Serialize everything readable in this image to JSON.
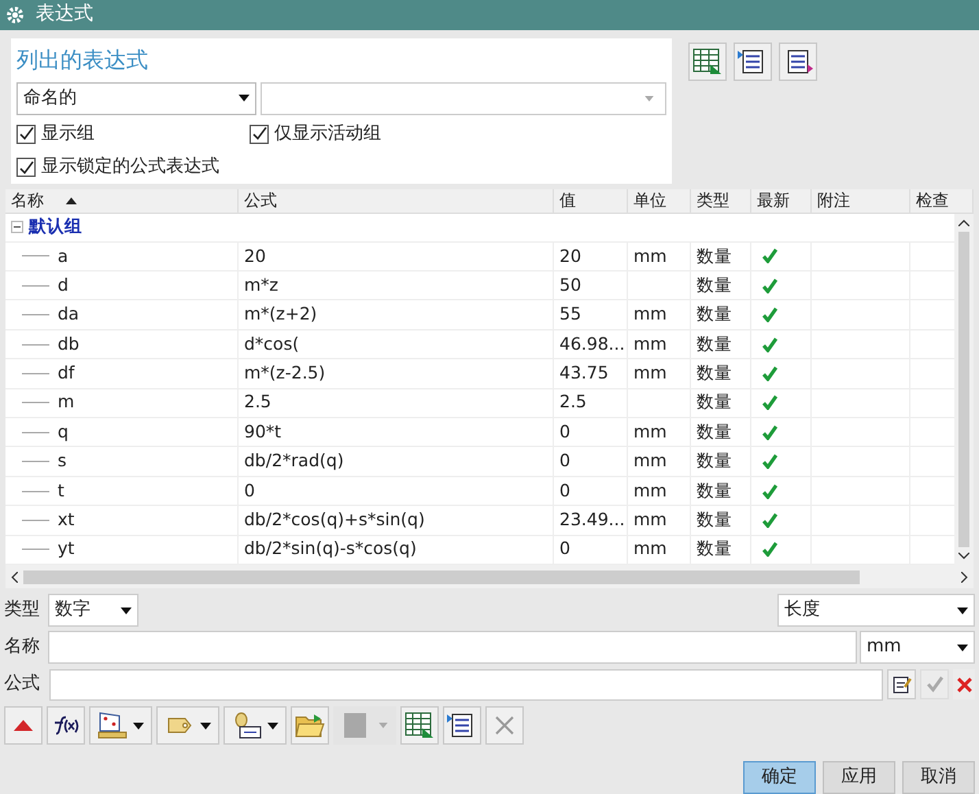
{
  "window": {
    "title": "表达式"
  },
  "listing": {
    "title": "列出的表达式",
    "filter": "命名的",
    "checkboxes": [
      {
        "label": "显示组",
        "checked": true
      },
      {
        "label": "仅显示活动组",
        "checked": true
      },
      {
        "label": "显示锁定的公式表达式",
        "checked": true
      }
    ]
  },
  "table": {
    "columns": [
      "名称",
      "公式",
      "值",
      "单位",
      "类型",
      "最新",
      "附注",
      "检查"
    ],
    "group": {
      "name": "默认组",
      "expanded": true,
      "children": [
        {
          "name": "a",
          "formula": "20",
          "value": "20",
          "unit": "mm",
          "type": "数量",
          "latest": true
        },
        {
          "name": "d",
          "formula": "m*z",
          "value": "50",
          "type": "数量",
          "latest": true
        },
        {
          "name": "da",
          "formula": "m*(z+2)",
          "value": "55",
          "unit": "mm",
          "type": "数量",
          "latest": true
        },
        {
          "name": "db",
          "formula": "d*cos(",
          "value": "46.98...",
          "unit": "mm",
          "type": "数量",
          "latest": true
        },
        {
          "name": "df",
          "formula": "m*(z-2.5)",
          "value": "43.75",
          "unit": "mm",
          "type": "数量",
          "latest": true
        },
        {
          "name": "m",
          "formula": "2.5",
          "value": "2.5",
          "type": "数量",
          "latest": true
        },
        {
          "name": "q",
          "formula": "90*t",
          "value": "0",
          "unit": "mm",
          "type": "数量",
          "latest": true
        },
        {
          "name": "s",
          "formula": "db/2*rad(q)",
          "value": "0",
          "unit": "mm",
          "type": "数量",
          "latest": true
        },
        {
          "name": "t",
          "formula": "0",
          "value": "0",
          "unit": "mm",
          "type": "数量",
          "latest": true
        },
        {
          "name": "xt",
          "formula": "db/2*cos(q)+s*sin(q)",
          "value": "23.49...",
          "unit": "mm",
          "type": "数量",
          "latest": true
        },
        {
          "name": "yt",
          "formula": "db/2*sin(q)-s*cos(q)",
          "value": "0",
          "unit": "mm",
          "type": "数量",
          "latest": true
        }
      ]
    }
  },
  "editor": {
    "type_label": "类型",
    "type_value": "数字",
    "dimension": "长度",
    "name_label": "名称",
    "unit": "mm",
    "formula_label": "公式"
  },
  "buttons": [
    {
      "label": "确定",
      "selected": true
    },
    {
      "label": "应用",
      "selected": false
    },
    {
      "label": "取消",
      "selected": false
    }
  ]
}
